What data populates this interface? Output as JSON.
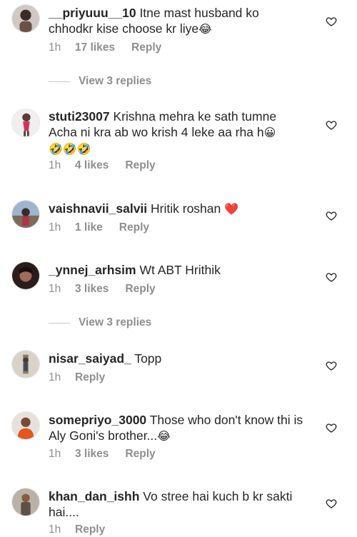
{
  "accent_text": "#262626",
  "muted_text": "#8e8e8e",
  "comments": [
    {
      "username": "__priyuuu__10",
      "text": "Itne mast husband ko chhodkr kise choose kr liye",
      "emoji": "😂",
      "time": "1h",
      "likes": "17 likes",
      "reply": "Reply",
      "view_replies": "View 3 replies",
      "icon": "heart-outline-icon"
    },
    {
      "username": "stuti23007",
      "text": "Krishna mehra ke sath tumne Acha ni kra ab wo krish 4 leke aa rha h",
      "emoji": "😀",
      "emoji_line2": "🤣🤣🤣",
      "time": "1h",
      "likes": "4 likes",
      "reply": "Reply"
    },
    {
      "username": "vaishnavii_salvii",
      "text": "Hritik roshan",
      "emoji": "❤️",
      "time": "1h",
      "likes": "1 like",
      "reply": "Reply"
    },
    {
      "username": "_ynnej_arhsim",
      "text": "Wt ABT Hrithik",
      "time": "1h",
      "likes": "3 likes",
      "reply": "Reply",
      "view_replies": "View 3 replies"
    },
    {
      "username": "nisar_saiyad_",
      "text": "Topp",
      "time": "1h",
      "reply": "Reply"
    },
    {
      "username": "somepriyo_3000",
      "text": "Those who don't know thi is Aly Goni's brother...",
      "emoji": "😂",
      "time": "1h",
      "likes": "3 likes",
      "reply": "Reply"
    },
    {
      "username": "khan_dan_ishh",
      "text": "Vo stree hai kuch b kr sakti hai....",
      "time": "1h",
      "reply": "Reply"
    }
  ]
}
